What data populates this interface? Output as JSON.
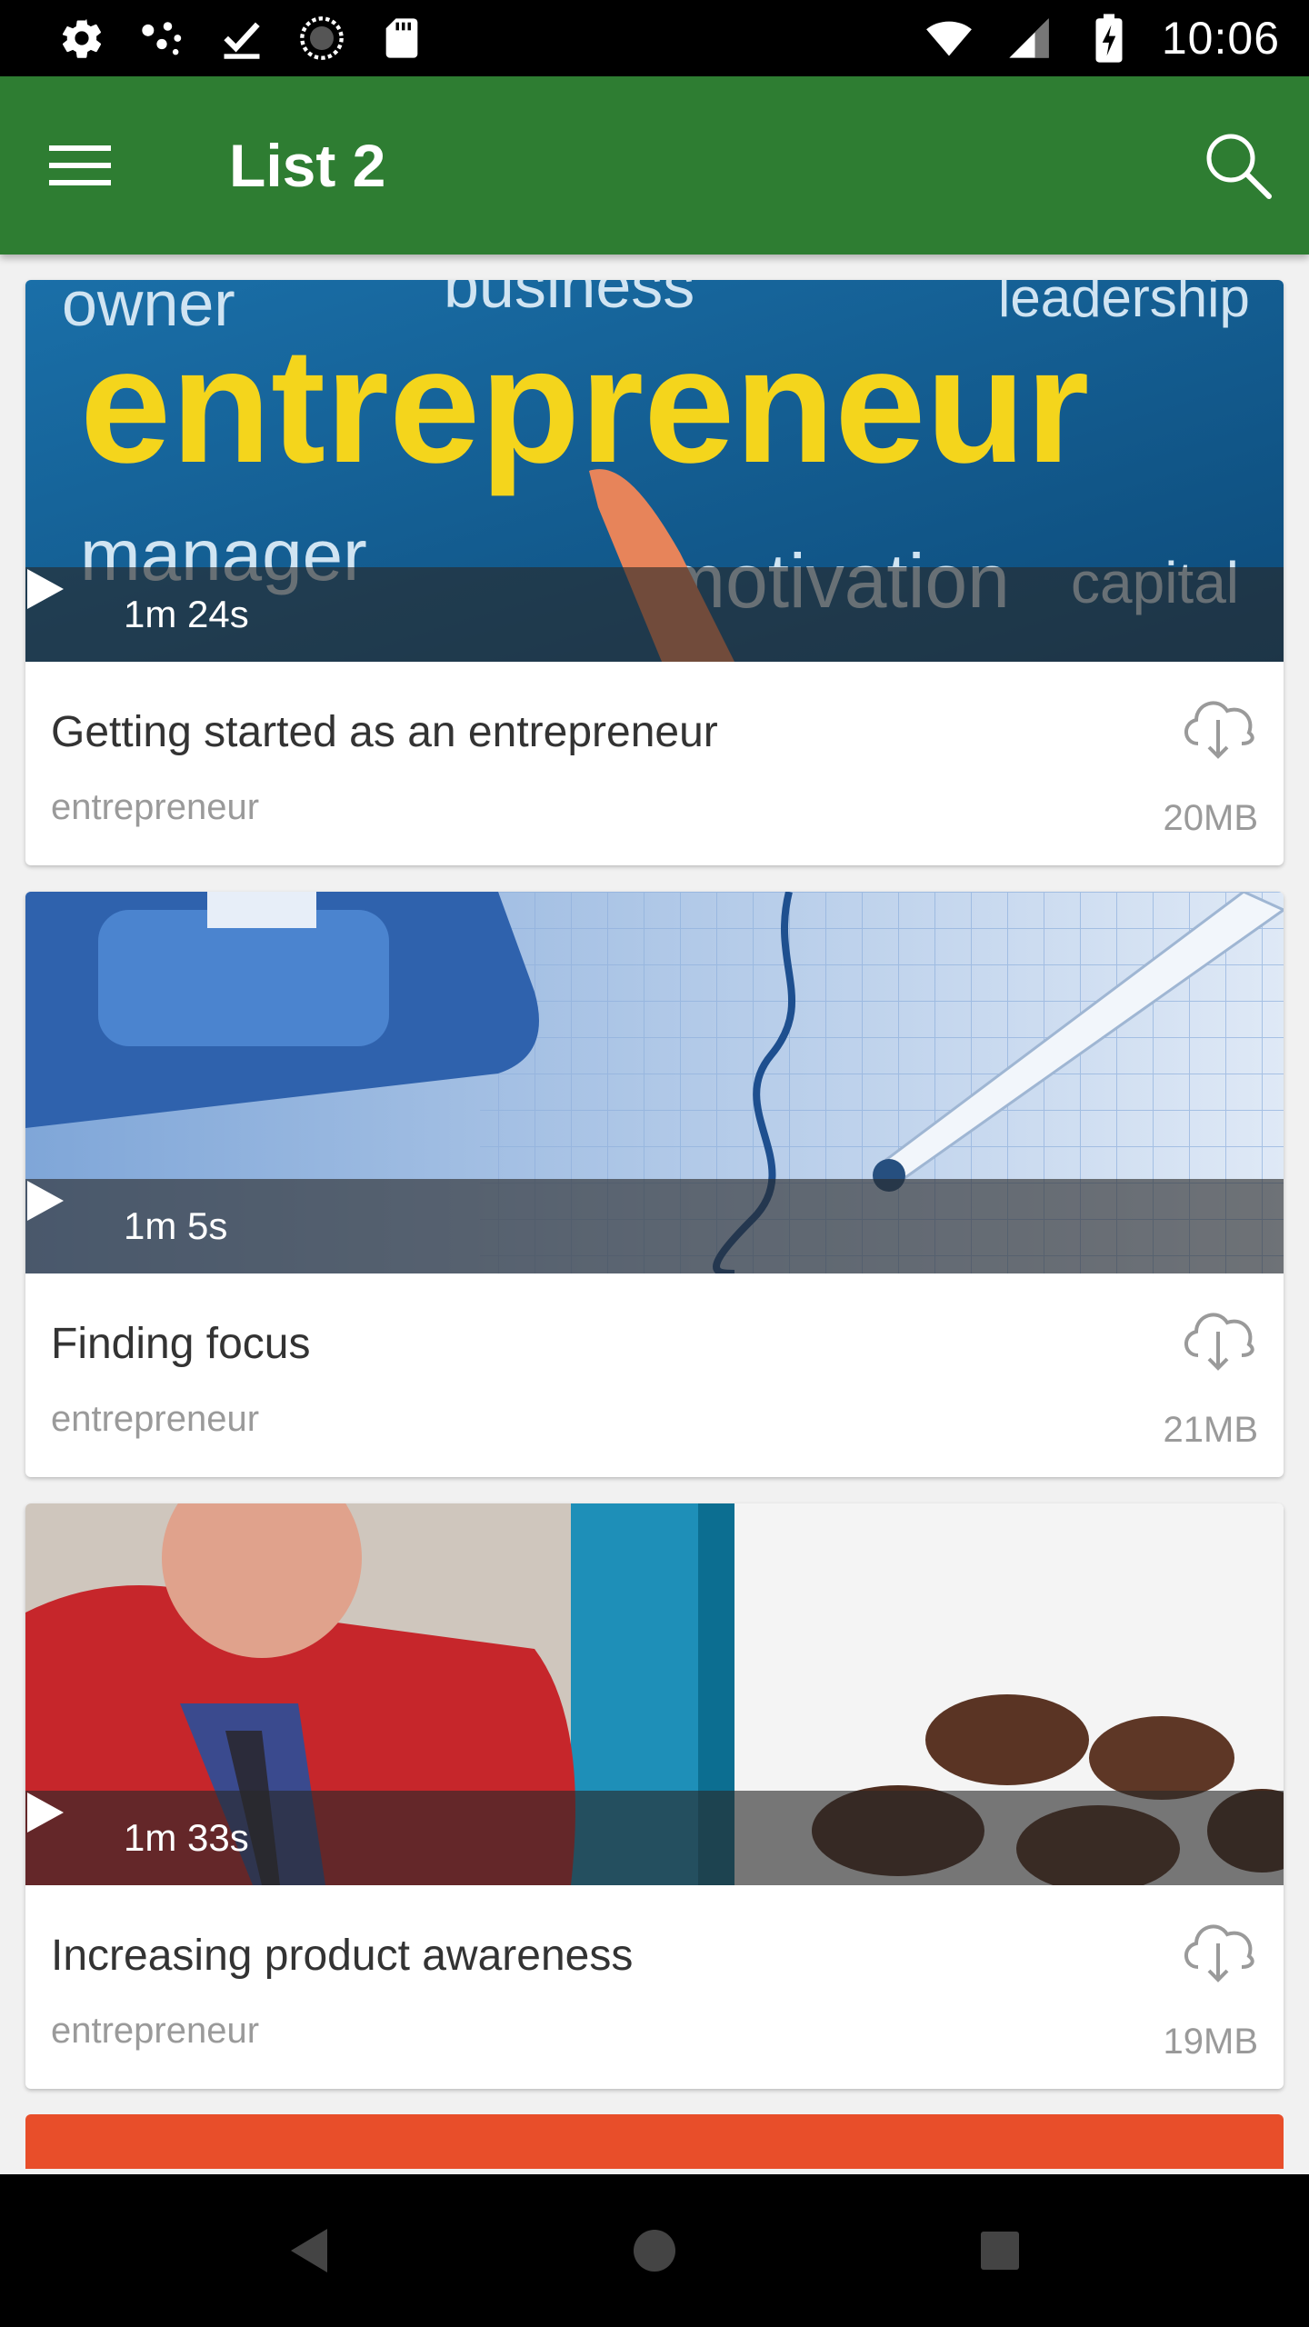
{
  "status_bar": {
    "time": "10:06",
    "left_icons": [
      "settings-icon",
      "dots-icon",
      "check-download-icon",
      "sync-icon",
      "sd-card-icon"
    ],
    "right_icons": [
      "wifi-icon",
      "signal-icon",
      "battery-charging-icon"
    ]
  },
  "app_bar": {
    "title": "List 2",
    "menu_icon": "menu-icon",
    "search_icon": "search-icon",
    "color": "#2e7d32"
  },
  "videos": [
    {
      "duration": "1m 24s",
      "title": "Getting started as an entrepreneur",
      "category": "entrepreneur",
      "size": "20MB",
      "thumbnail": "entrepreneur word cloud with pointing finger"
    },
    {
      "duration": "1m 5s",
      "title": "Finding focus",
      "category": "entrepreneur",
      "size": "21MB",
      "thumbnail": "calculator and pen on graph paper"
    },
    {
      "duration": "1m 33s",
      "title": "Increasing product awareness",
      "category": "entrepreneur",
      "size": "19MB",
      "thumbnail": "man in red sweater and coffee beans"
    }
  ],
  "nav_bar": {
    "icons": [
      "back-icon",
      "home-icon",
      "recents-icon"
    ]
  }
}
